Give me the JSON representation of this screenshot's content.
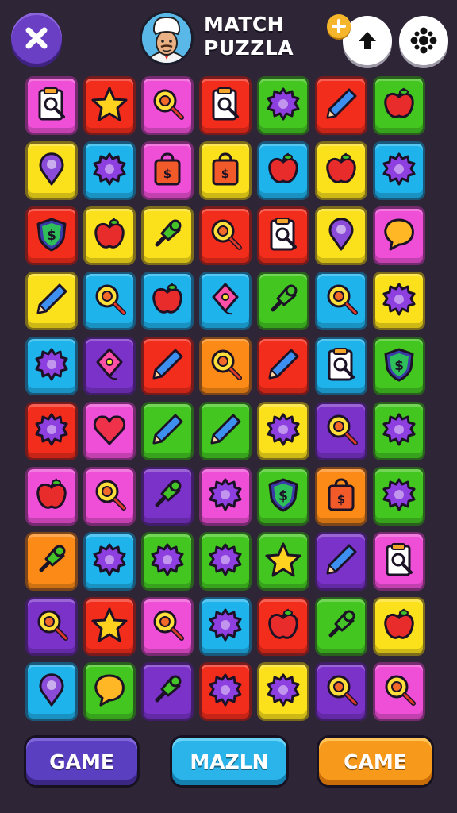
{
  "header": {
    "title_line1": "MATCH",
    "title_line2": "PUZZLA"
  },
  "buttons": {
    "left": "GAME",
    "middle": "MAZLN",
    "right": "CAME"
  },
  "colors": {
    "background": "#2e2637",
    "pink": "#ee4fd6",
    "red": "#f22d1b",
    "yellow": "#fbe11c",
    "green": "#44c621",
    "blue": "#1fb3ec",
    "purple": "#7a32c8",
    "orange": "#fb8a17"
  },
  "board": {
    "rows": [
      [
        {
          "color": "pink",
          "icon": "clipboard-icon"
        },
        {
          "color": "red",
          "icon": "star-icon"
        },
        {
          "color": "pink",
          "icon": "magnifier-icon"
        },
        {
          "color": "red",
          "icon": "clipboard-icon"
        },
        {
          "color": "green",
          "icon": "gear-icon"
        },
        {
          "color": "red",
          "icon": "pencil-icon"
        },
        {
          "color": "green",
          "icon": "apple-icon"
        }
      ],
      [
        {
          "color": "yellow",
          "icon": "pin-icon"
        },
        {
          "color": "blue",
          "icon": "gear-icon"
        },
        {
          "color": "pink",
          "icon": "bag-icon"
        },
        {
          "color": "yellow",
          "icon": "bag-icon"
        },
        {
          "color": "blue",
          "icon": "apple-icon"
        },
        {
          "color": "yellow",
          "icon": "apple-icon"
        },
        {
          "color": "blue",
          "icon": "gear-icon"
        }
      ],
      [
        {
          "color": "red",
          "icon": "shield-icon"
        },
        {
          "color": "yellow",
          "icon": "apple-icon"
        },
        {
          "color": "yellow",
          "icon": "push-pin-icon"
        },
        {
          "color": "red",
          "icon": "magnifier-icon"
        },
        {
          "color": "red",
          "icon": "clipboard-icon"
        },
        {
          "color": "yellow",
          "icon": "pin-icon"
        },
        {
          "color": "pink",
          "icon": "bubble-icon"
        }
      ],
      [
        {
          "color": "yellow",
          "icon": "pencil-icon"
        },
        {
          "color": "blue",
          "icon": "magnifier-icon"
        },
        {
          "color": "blue",
          "icon": "apple-icon"
        },
        {
          "color": "blue",
          "icon": "kite-icon"
        },
        {
          "color": "green",
          "icon": "push-pin-icon"
        },
        {
          "color": "blue",
          "icon": "magnifier-icon"
        },
        {
          "color": "yellow",
          "icon": "gear-icon"
        }
      ],
      [
        {
          "color": "blue",
          "icon": "gear-icon"
        },
        {
          "color": "purple",
          "icon": "kite-icon"
        },
        {
          "color": "red",
          "icon": "pencil-icon"
        },
        {
          "color": "orange",
          "icon": "magnifier-icon"
        },
        {
          "color": "red",
          "icon": "pencil-icon"
        },
        {
          "color": "blue",
          "icon": "clipboard-icon"
        },
        {
          "color": "green",
          "icon": "shield-icon"
        }
      ],
      [
        {
          "color": "red",
          "icon": "gear-icon"
        },
        {
          "color": "pink",
          "icon": "heart-icon"
        },
        {
          "color": "green",
          "icon": "pencil-icon"
        },
        {
          "color": "green",
          "icon": "pencil-icon"
        },
        {
          "color": "yellow",
          "icon": "gear-icon"
        },
        {
          "color": "purple",
          "icon": "magnifier-icon"
        },
        {
          "color": "green",
          "icon": "gear-icon"
        }
      ],
      [
        {
          "color": "pink",
          "icon": "apple-icon"
        },
        {
          "color": "pink",
          "icon": "magnifier-icon"
        },
        {
          "color": "purple",
          "icon": "push-pin-icon"
        },
        {
          "color": "pink",
          "icon": "gear-icon"
        },
        {
          "color": "green",
          "icon": "shield-icon"
        },
        {
          "color": "orange",
          "icon": "bag-icon"
        },
        {
          "color": "green",
          "icon": "gear-icon"
        }
      ],
      [
        {
          "color": "orange",
          "icon": "push-pin-icon"
        },
        {
          "color": "blue",
          "icon": "gear-icon"
        },
        {
          "color": "green",
          "icon": "gear-icon"
        },
        {
          "color": "green",
          "icon": "gear-icon"
        },
        {
          "color": "green",
          "icon": "star-icon"
        },
        {
          "color": "purple",
          "icon": "pencil-icon"
        },
        {
          "color": "pink",
          "icon": "clipboard-icon"
        }
      ],
      [
        {
          "color": "purple",
          "icon": "magnifier-icon"
        },
        {
          "color": "red",
          "icon": "star-icon"
        },
        {
          "color": "pink",
          "icon": "magnifier-icon"
        },
        {
          "color": "blue",
          "icon": "gear-icon"
        },
        {
          "color": "red",
          "icon": "apple-icon"
        },
        {
          "color": "green",
          "icon": "push-pin-icon"
        },
        {
          "color": "yellow",
          "icon": "apple-icon"
        }
      ],
      [
        {
          "color": "blue",
          "icon": "pin-icon"
        },
        {
          "color": "green",
          "icon": "bubble-icon"
        },
        {
          "color": "purple",
          "icon": "push-pin-icon"
        },
        {
          "color": "red",
          "icon": "gear-icon"
        },
        {
          "color": "yellow",
          "icon": "gear-icon"
        },
        {
          "color": "purple",
          "icon": "magnifier-icon"
        },
        {
          "color": "pink",
          "icon": "magnifier-icon"
        }
      ]
    ]
  }
}
